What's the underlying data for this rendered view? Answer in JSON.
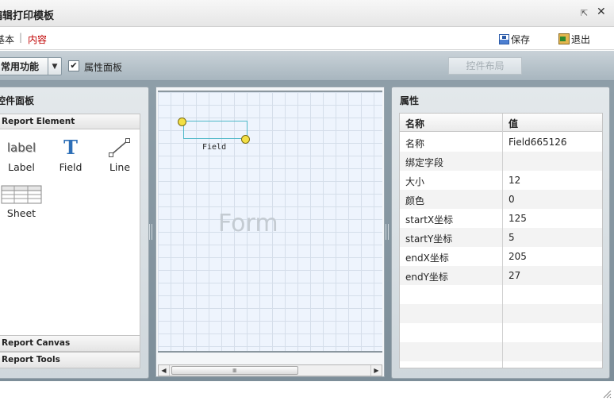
{
  "window": {
    "title": "编辑打印模板",
    "restore_icon": "restore-icon",
    "close_icon": "close-icon"
  },
  "menu": {
    "basic": "基本",
    "content": "内容",
    "save": "保存",
    "exit": "退出"
  },
  "toolbar": {
    "function_select": "常用功能",
    "property_panel_checked": true,
    "property_panel_label": "属性面板",
    "layout_button": "控件布局"
  },
  "left_panel": {
    "title": "控件面板",
    "sections": [
      "Report Element",
      "Report Canvas",
      "Report Tools"
    ],
    "items": [
      {
        "label": "Label",
        "icon": "label-icon",
        "glyph": "label"
      },
      {
        "label": "Field",
        "icon": "text-field-icon",
        "glyph": "T"
      },
      {
        "label": "Line",
        "icon": "line-icon"
      },
      {
        "label": "Sheet",
        "icon": "sheet-icon"
      }
    ]
  },
  "canvas": {
    "watermark": "Form",
    "selected_field_label": "Field",
    "scroll_grip": "IIII"
  },
  "right_panel": {
    "title": "属性",
    "headers": {
      "name": "名称",
      "value": "值"
    },
    "rows": [
      {
        "name": "名称",
        "value": "Field665126"
      },
      {
        "name": "绑定字段",
        "value": ""
      },
      {
        "name": "大小",
        "value": "12"
      },
      {
        "name": "颜色",
        "value": "0"
      },
      {
        "name": "startX坐标",
        "value": "125"
      },
      {
        "name": "startY坐标",
        "value": "5"
      },
      {
        "name": "endX坐标",
        "value": "205"
      },
      {
        "name": "endY坐标",
        "value": "27"
      }
    ]
  },
  "colors": {
    "accent_red": "#c00000",
    "handle_yellow": "#f3e045",
    "field_border": "#4fb8c8",
    "field_icon_blue": "#2e6fb7"
  }
}
